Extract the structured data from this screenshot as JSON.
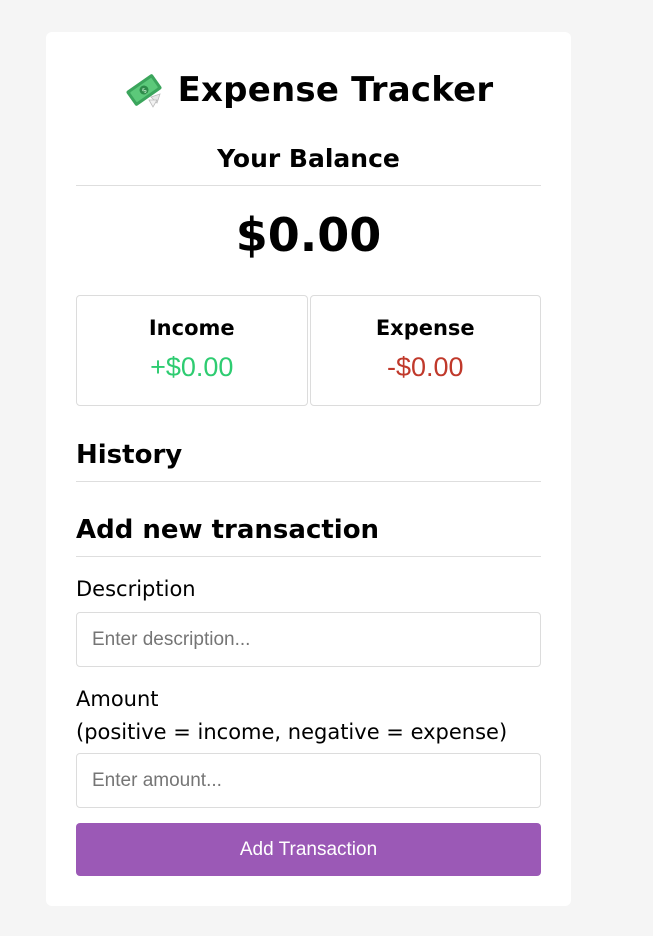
{
  "app": {
    "title": "Expense Tracker",
    "icon": "money-with-wings-icon"
  },
  "balance": {
    "label": "Your Balance",
    "value": "$0.00"
  },
  "summary": {
    "income_label": "Income",
    "income_value": "+$0.00",
    "expense_label": "Expense",
    "expense_value": "-$0.00",
    "income_color": "#2ecc71",
    "expense_color": "#c0392b"
  },
  "history": {
    "title": "History",
    "items": []
  },
  "form": {
    "title": "Add new transaction",
    "description_label": "Description",
    "description_placeholder": "Enter description...",
    "description_value": "",
    "amount_label": "Amount",
    "amount_hint": "(positive = income, negative = expense)",
    "amount_placeholder": "Enter amount...",
    "amount_value": "",
    "submit_label": "Add Transaction",
    "submit_color": "#9b59b6"
  }
}
